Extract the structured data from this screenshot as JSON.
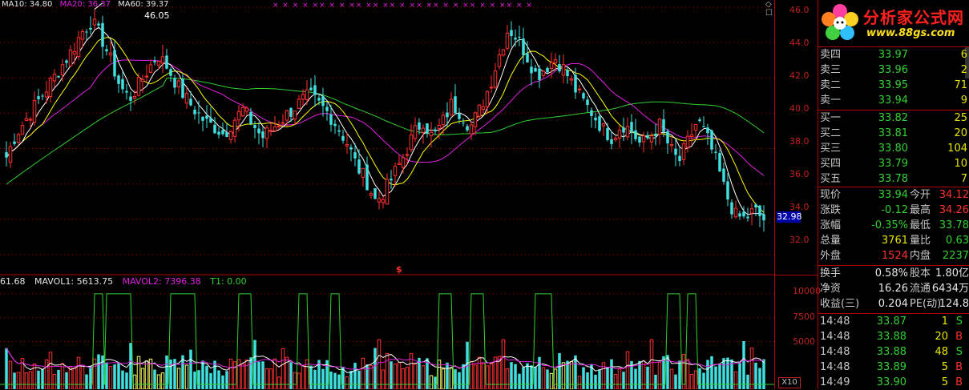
{
  "top_legend": {
    "ma_a": "MA10: 34.80",
    "ma_b": "MA20: 36.37",
    "ma_c": "MA60: 39.37"
  },
  "peak_label": "46.05",
  "dollar_marker": "$",
  "price_axis": [
    "46.0",
    "44.0",
    "42.0",
    "40.0",
    "38.0",
    "36.0",
    "34.0",
    "32.0"
  ],
  "current_price_marker": "32.98",
  "volume_axis": [
    "10000",
    "7500",
    "5000"
  ],
  "volume_multiplier": "X10",
  "volume_legend": {
    "vol": "61.68",
    "mavol1": "MAVOL1: 5613.75",
    "mavol2": "MAVOL2: 7396.38",
    "t1": "T1: 0.00"
  },
  "logo": {
    "title": "分析家公式网",
    "url": "www.88gs.com"
  },
  "colors": {
    "up": "#ff3030",
    "down": "#40e0e0",
    "ma_white": "#ffffff",
    "ma_yellow": "#ffff00",
    "ma_magenta": "#e020e0",
    "ma_green": "#30d030",
    "signal": "#30d030",
    "grid": "#b00000"
  },
  "order_book": {
    "sell": [
      {
        "label": "卖四",
        "price": "33.97",
        "vol": "6"
      },
      {
        "label": "卖三",
        "price": "33.96",
        "vol": "2"
      },
      {
        "label": "卖二",
        "price": "33.95",
        "vol": "71"
      },
      {
        "label": "卖一",
        "price": "33.94",
        "vol": "9"
      }
    ],
    "buy": [
      {
        "label": "买一",
        "price": "33.82",
        "vol": "25"
      },
      {
        "label": "买二",
        "price": "33.81",
        "vol": "20"
      },
      {
        "label": "买三",
        "price": "33.80",
        "vol": "104"
      },
      {
        "label": "买四",
        "price": "33.79",
        "vol": "10"
      },
      {
        "label": "买五",
        "price": "33.78",
        "vol": "7"
      }
    ]
  },
  "quote": {
    "rows": [
      {
        "l1": "现价",
        "v1": "33.94",
        "l2": "今开",
        "v2": "34.12"
      },
      {
        "l1": "涨跌",
        "v1": "-0.12",
        "l2": "最高",
        "v2": "34.26"
      },
      {
        "l1": "涨幅",
        "v1": "-0.35%",
        "l2": "最低",
        "v2": "33.78"
      },
      {
        "l1": "总量",
        "v1": "3761",
        "l2": "量比",
        "v2": "0.63"
      },
      {
        "l1": "外盘",
        "v1": "1524",
        "l2": "内盘",
        "v2": "2237"
      }
    ],
    "fund_rows": [
      {
        "l1": "换手",
        "v1": "0.58%",
        "l2": "股本",
        "v2": "1.80亿"
      },
      {
        "l1": "净资",
        "v1": "16.26",
        "l2": "流通",
        "v2": "6434万"
      },
      {
        "l1": "收益(三)",
        "v1": "0.204",
        "l2": "PE(动)",
        "v2": "124.8"
      }
    ]
  },
  "ticks": [
    {
      "time": "14:48",
      "price": "33.87",
      "vol": "1",
      "side": "S"
    },
    {
      "time": "14:48",
      "price": "33.88",
      "vol": "20",
      "side": "B"
    },
    {
      "time": "14:48",
      "price": "33.88",
      "vol": "48",
      "side": "S"
    },
    {
      "time": "14:48",
      "price": "33.89",
      "vol": "5",
      "side": "B"
    },
    {
      "time": "14:49",
      "price": "33.90",
      "vol": "5",
      "side": "B"
    }
  ],
  "chart_data": {
    "type": "candlestick",
    "y_axis_range": [
      31.0,
      46.4
    ],
    "volume_axis_range": [
      0,
      11000
    ],
    "series_names": [
      "MA10",
      "MA20",
      "MA60"
    ],
    "approx_close_path": [
      37.5,
      38.8,
      39.6,
      40.4,
      41.2,
      42.0,
      42.8,
      43.6,
      44.6,
      45.2,
      44.3,
      43.0,
      41.5,
      40.8,
      41.6,
      42.5,
      43.3,
      42.6,
      41.6,
      40.8,
      40.1,
      39.5,
      39.2,
      38.8,
      39.6,
      40.2,
      39.4,
      38.6,
      39.1,
      39.6,
      40.1,
      40.6,
      41.0,
      40.5,
      40.0,
      39.2,
      38.3,
      37.0,
      36.2,
      35.0,
      35.6,
      36.6,
      37.6,
      38.8,
      39.6,
      38.6,
      39.4,
      40.5,
      40.0,
      39.2,
      40.2,
      41.5,
      43.2,
      44.8,
      44.2,
      43.2,
      42.1,
      42.6,
      43.1,
      42.4,
      41.4,
      40.6,
      39.9,
      39.1,
      38.6,
      39.4,
      39.0,
      38.2,
      38.7,
      39.3,
      38.1,
      37.2,
      38.4,
      39.6,
      38.6,
      37.2,
      35.4,
      34.2,
      34.0,
      34.5,
      33.94
    ],
    "ma_a_endpoint": 34.4,
    "ma_b_endpoint": 36.6,
    "ma_c_endpoint": 39.8
  }
}
